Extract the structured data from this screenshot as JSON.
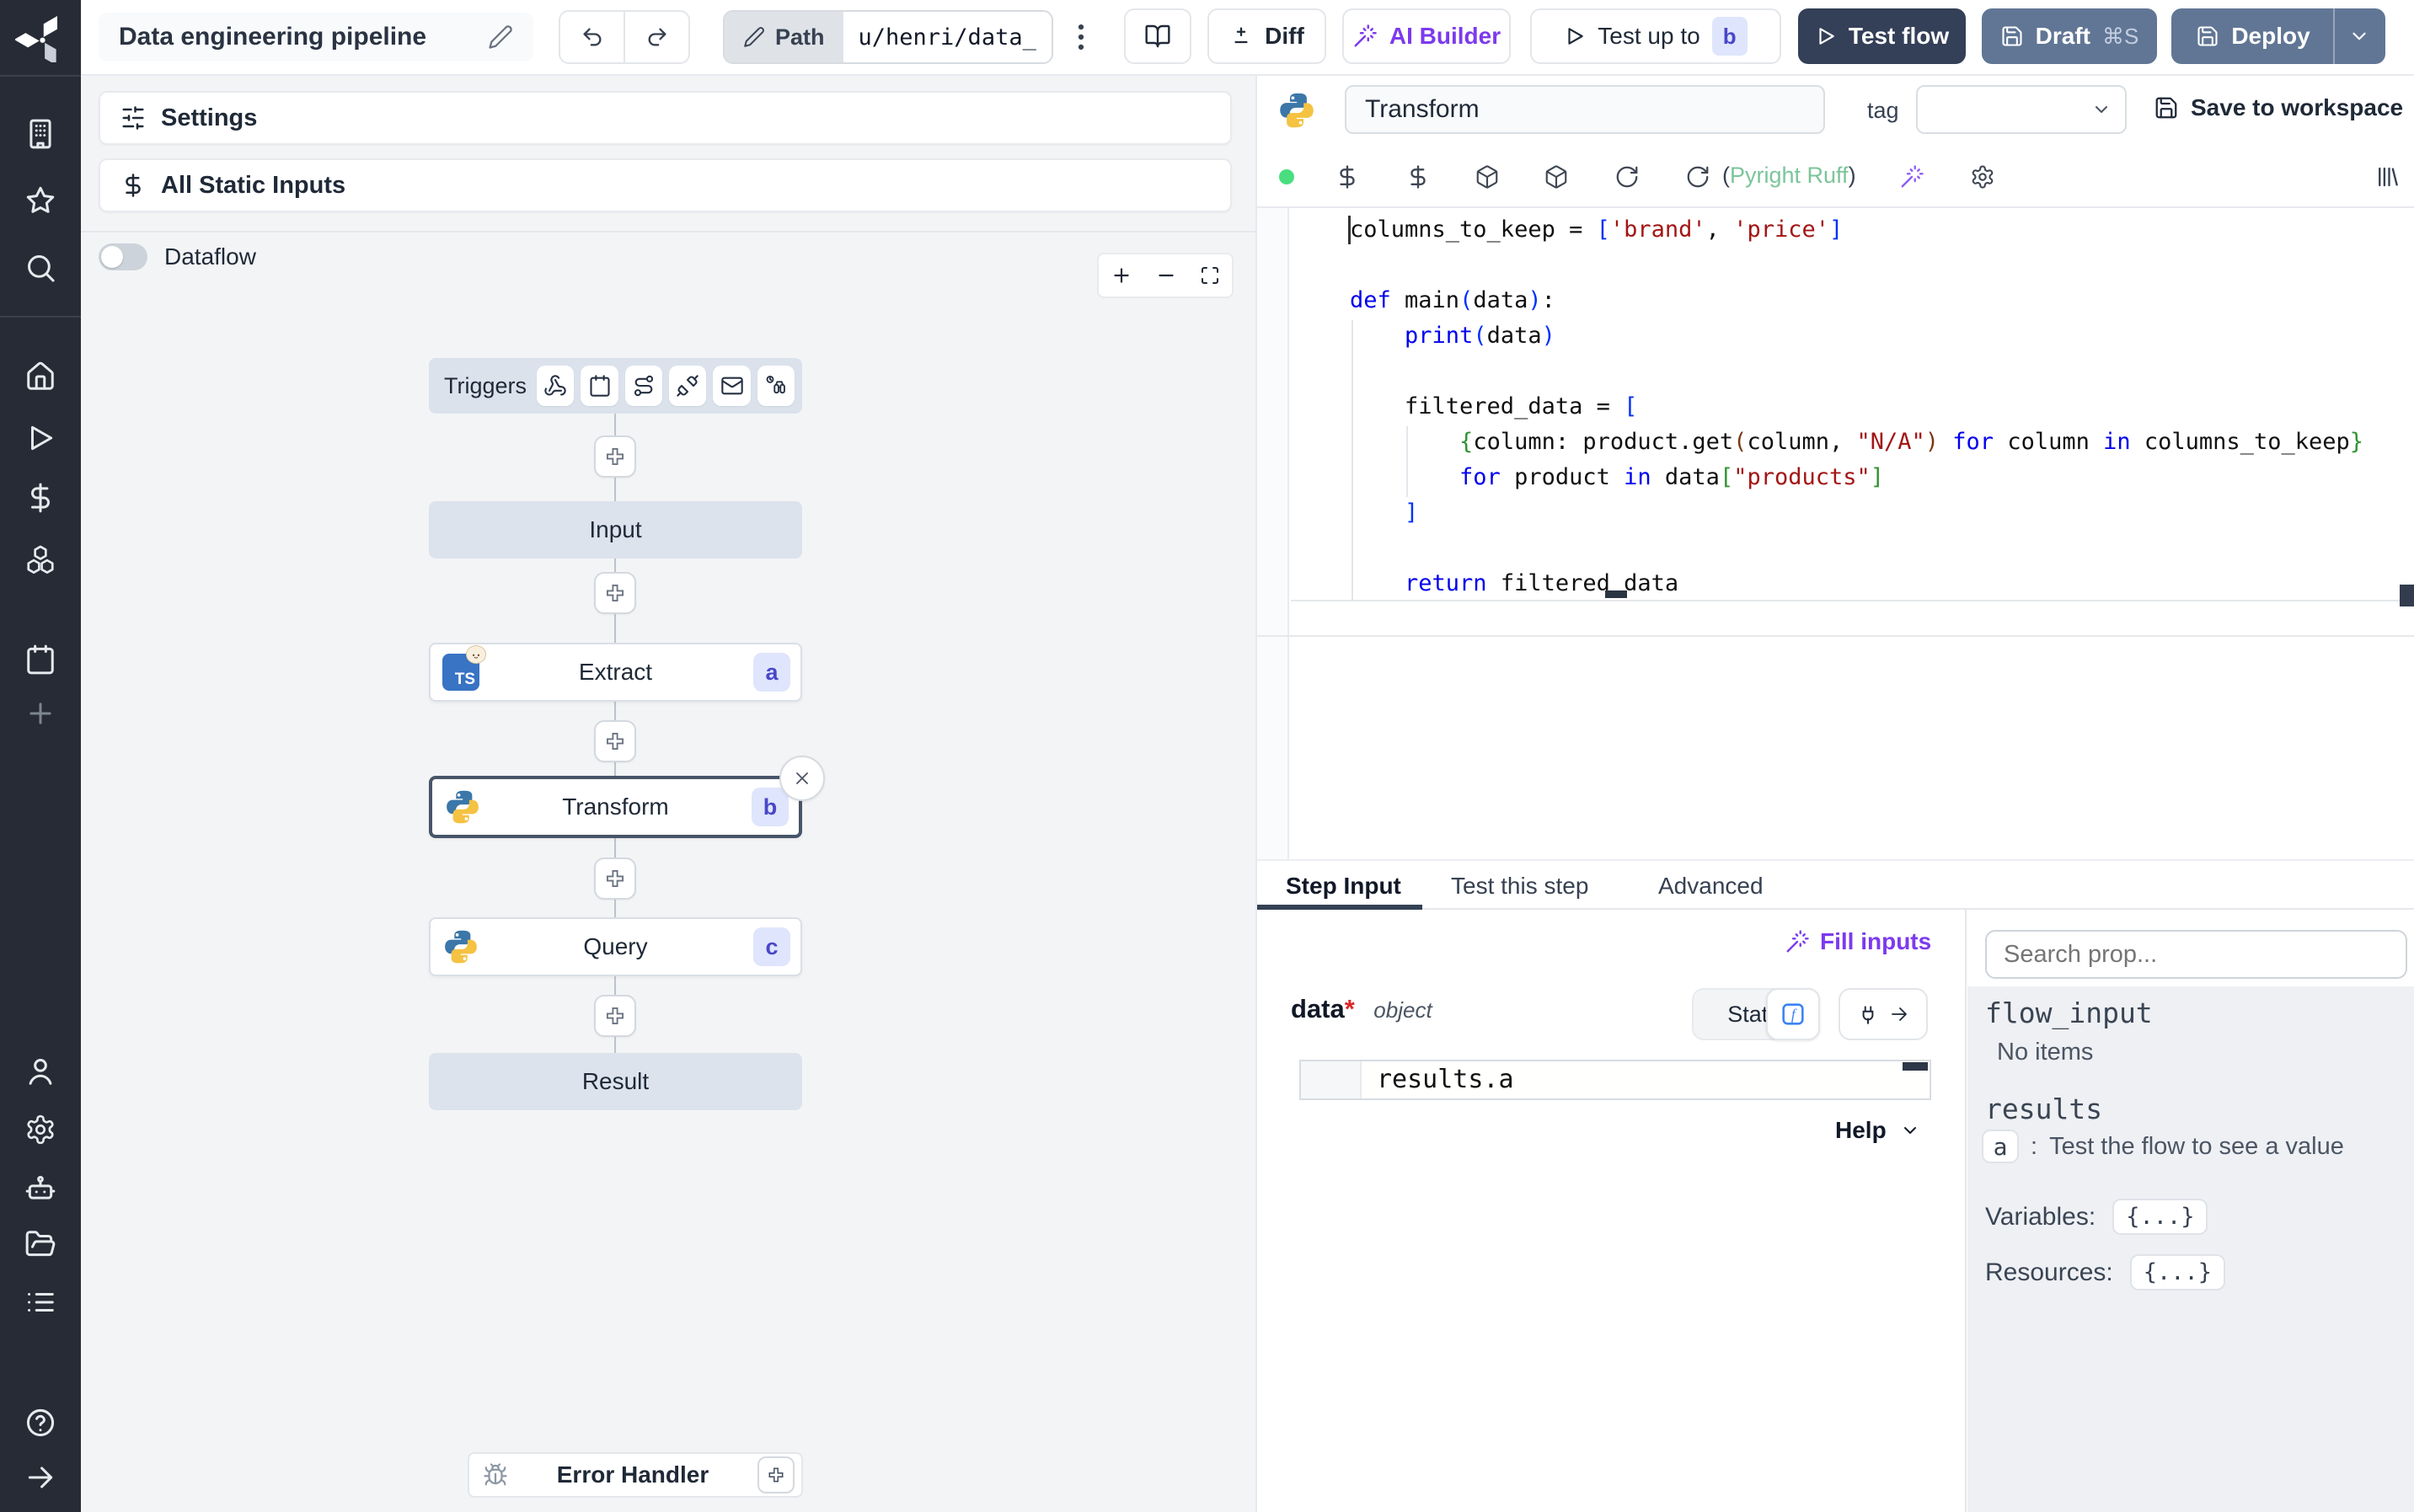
{
  "topbar": {
    "title": "Data engineering pipeline",
    "path_label": "Path",
    "path_value": "u/henri/data_",
    "diff": "Diff",
    "ai_builder": "AI Builder",
    "test_up_to": "Test up to",
    "test_up_to_badge": "b",
    "test_flow": "Test flow",
    "draft": "Draft",
    "draft_shortcut": "⌘S",
    "deploy": "Deploy"
  },
  "flow": {
    "settings": "Settings",
    "all_static_inputs": "All Static Inputs",
    "dataflow": "Dataflow",
    "triggers_label": "Triggers",
    "nodes": {
      "input": "Input",
      "extract": "Extract",
      "extract_badge": "a",
      "extract_lang": "TS",
      "transform": "Transform",
      "transform_badge": "b",
      "query": "Query",
      "query_badge": "c",
      "result": "Result"
    },
    "error_handler": "Error Handler"
  },
  "editor": {
    "step_name": "Transform",
    "tag_label": "tag",
    "save_label": "Save to workspace",
    "lint_open": "(",
    "lint": "Pyright Ruff",
    "lint_close": ")",
    "code_lines": [
      [
        [
          "d",
          "columns_to_keep = "
        ],
        [
          "b1",
          "["
        ],
        [
          "s",
          "'brand'"
        ],
        [
          "d",
          ", "
        ],
        [
          "s",
          "'price'"
        ],
        [
          "b1",
          "]"
        ]
      ],
      [],
      [
        [
          "k",
          "def"
        ],
        [
          "d",
          " main"
        ],
        [
          "b1",
          "("
        ],
        [
          "d",
          "data"
        ],
        [
          "b1",
          ")"
        ],
        [
          "d",
          ":"
        ]
      ],
      [
        [
          "d",
          "    "
        ],
        [
          "k",
          "print"
        ],
        [
          "b1",
          "("
        ],
        [
          "d",
          "data"
        ],
        [
          "b1",
          ")"
        ]
      ],
      [],
      [
        [
          "d",
          "    filtered_data = "
        ],
        [
          "b1",
          "["
        ]
      ],
      [
        [
          "d",
          "        "
        ],
        [
          "b2",
          "{"
        ],
        [
          "d",
          "column: product.get"
        ],
        [
          "b3",
          "("
        ],
        [
          "d",
          "column, "
        ],
        [
          "s",
          "\"N/A\""
        ],
        [
          "b3",
          ")"
        ],
        [
          "d",
          " "
        ],
        [
          "k",
          "for"
        ],
        [
          "d",
          " column "
        ],
        [
          "k",
          "in"
        ],
        [
          "d",
          " columns_to_keep"
        ],
        [
          "b2",
          "}"
        ]
      ],
      [
        [
          "d",
          "        "
        ],
        [
          "k",
          "for"
        ],
        [
          "d",
          " product "
        ],
        [
          "k",
          "in"
        ],
        [
          "d",
          " data"
        ],
        [
          "b2",
          "["
        ],
        [
          "s",
          "\"products\""
        ],
        [
          "b2",
          "]"
        ]
      ],
      [
        [
          "d",
          "    "
        ],
        [
          "b1",
          "]"
        ]
      ],
      [],
      [
        [
          "d",
          "    "
        ],
        [
          "k",
          "return"
        ],
        [
          "d",
          " filtered_data"
        ]
      ]
    ]
  },
  "tabs": {
    "step_input": "Step Input",
    "test_this_step": "Test this step",
    "advanced": "Advanced"
  },
  "step_input": {
    "fill_inputs": "Fill inputs",
    "arg_name": "data",
    "arg_required": "*",
    "arg_type": "object",
    "static_label": "Static",
    "expr": "results.a",
    "help": "Help"
  },
  "props": {
    "search_placeholder": "Search prop...",
    "flow_input": "flow_input",
    "no_items": "No items",
    "results": "results",
    "result_key": "a",
    "result_sep": ":",
    "result_hint": "Test the flow to see a value",
    "variables_label": "Variables:",
    "variables_value": "{...}",
    "resources_label": "Resources:",
    "resources_value": "{...}"
  },
  "colors": {
    "accent_purple": "#7c3aed",
    "badge_bg": "#dfe5fc",
    "badge_text": "#4947c8",
    "dark_button": "#343f58",
    "slate_button": "#617695",
    "success_green": "#4ade80",
    "python_blue": "#3b77a8",
    "python_yellow": "#f5c242",
    "ts_blue": "#3873c4",
    "sidebar_bg": "#262b35"
  }
}
